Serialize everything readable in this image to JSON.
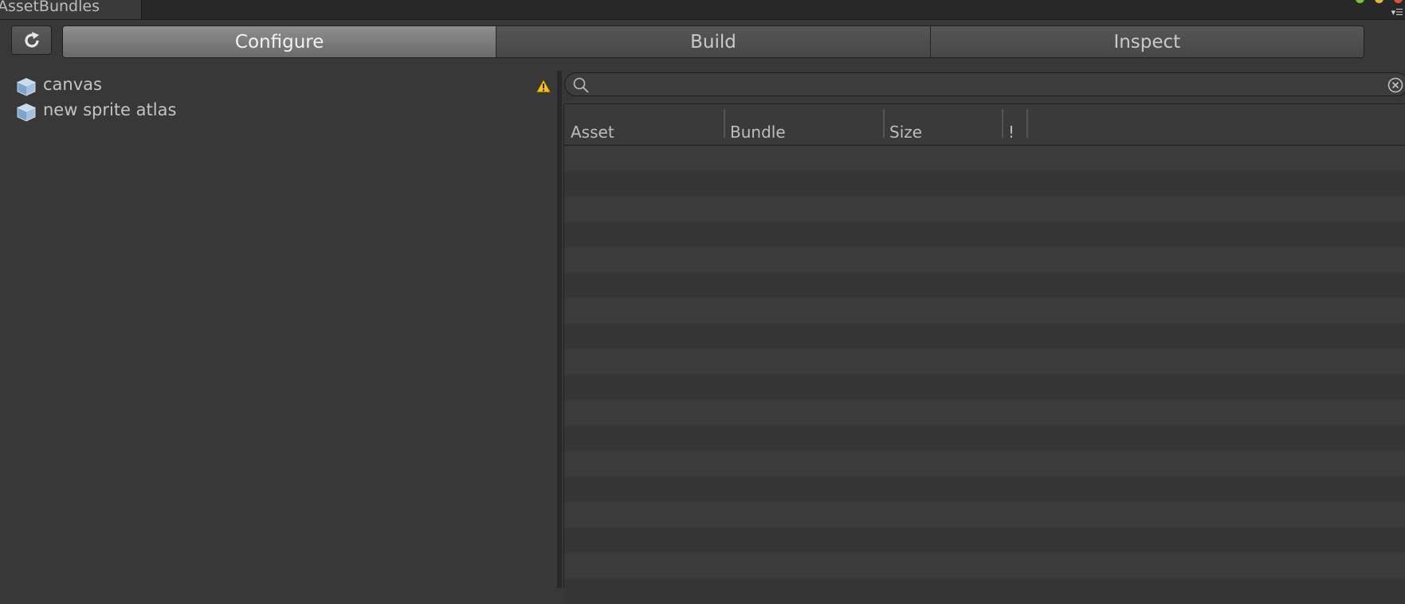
{
  "window": {
    "tab_title": "AssetBundles",
    "menu_glyph": "▾☰"
  },
  "toolbar": {
    "refresh_icon": "refresh-icon",
    "modes": [
      {
        "label": "Configure",
        "active": true
      },
      {
        "label": "Build",
        "active": false
      },
      {
        "label": "Inspect",
        "active": false
      }
    ]
  },
  "bundle_list": {
    "items": [
      {
        "label": "canvas",
        "icon": "bundle-cube-icon",
        "warning": true
      },
      {
        "label": "new sprite atlas",
        "icon": "bundle-cube-icon",
        "warning": false
      }
    ]
  },
  "search": {
    "value": "",
    "placeholder": ""
  },
  "asset_table": {
    "columns": [
      {
        "label": "Asset"
      },
      {
        "label": "Bundle"
      },
      {
        "label": "Size"
      },
      {
        "label": "!"
      }
    ],
    "rows": []
  },
  "colors": {
    "accent_active": "#7a7a7a",
    "background": "#383838",
    "warning": "#f2c21b"
  }
}
